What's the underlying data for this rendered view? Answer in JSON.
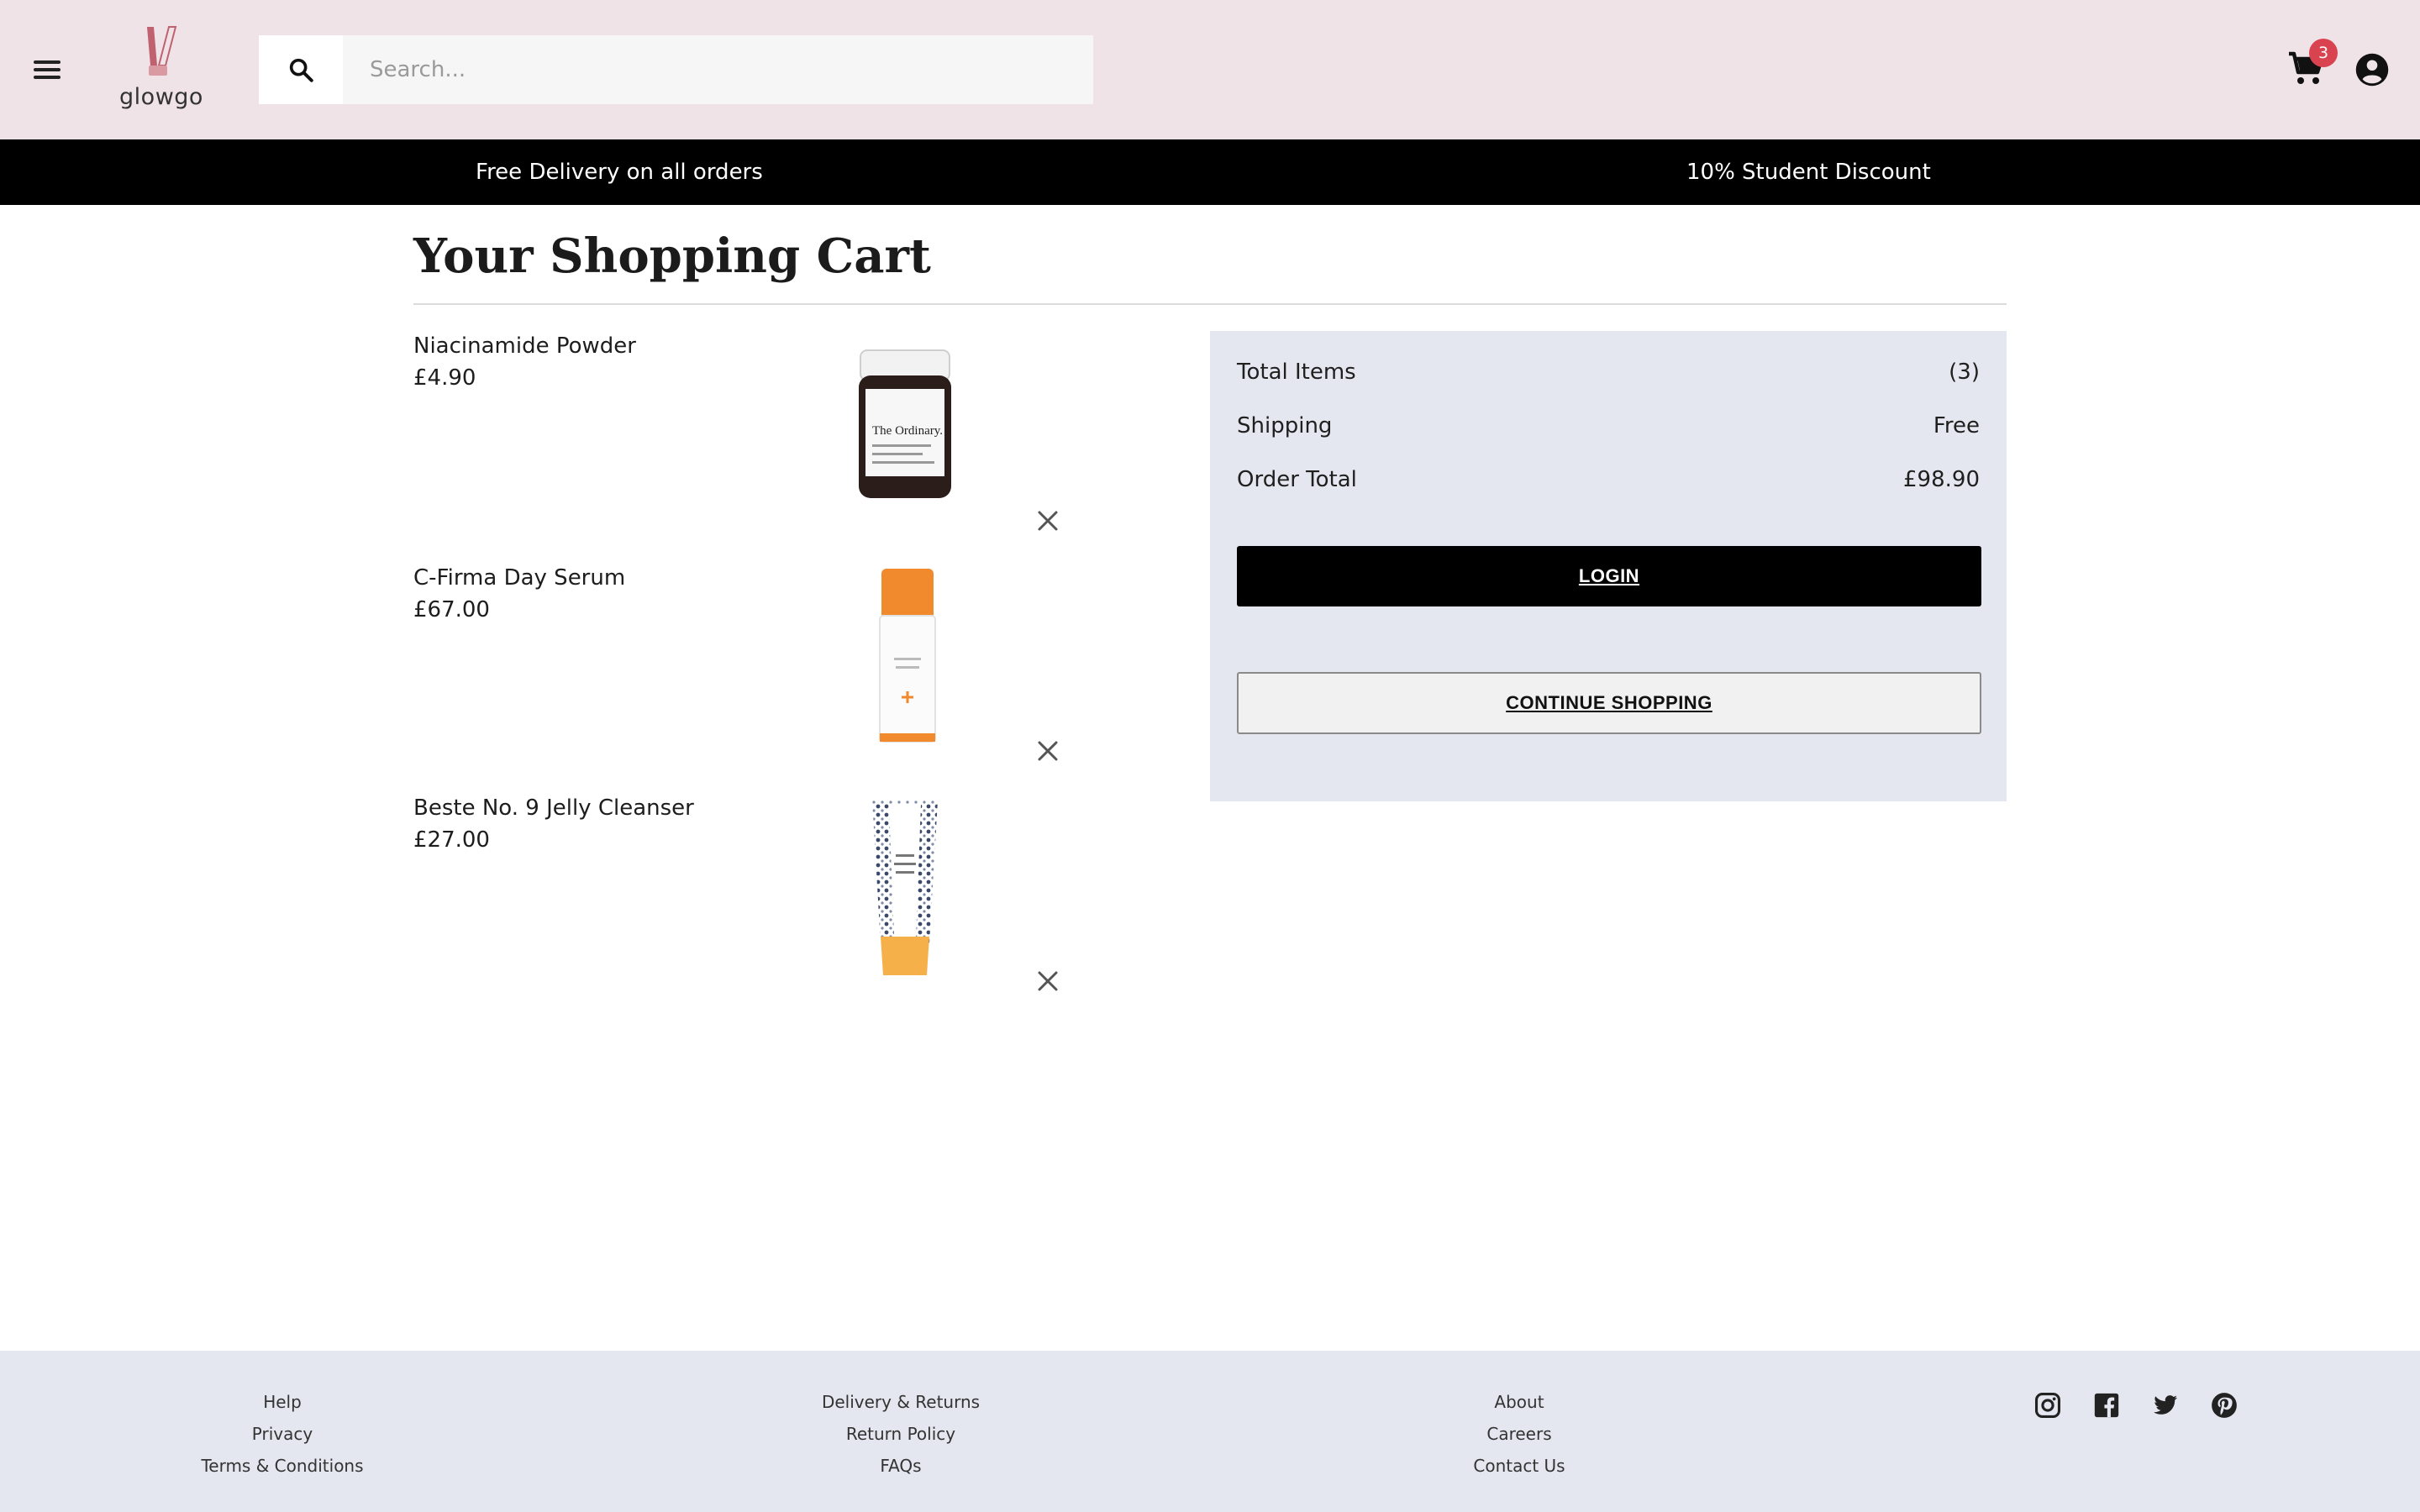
{
  "header": {
    "logo_text": "glowgo",
    "search_placeholder": "Search...",
    "cart_count": "3"
  },
  "promo": {
    "left": "Free Delivery on all orders",
    "right": "10% Student Discount"
  },
  "page": {
    "title": "Your Shopping Cart"
  },
  "cart": {
    "items": [
      {
        "name": "Niacinamide Powder",
        "price": "£4.90"
      },
      {
        "name": "C-Firma Day Serum",
        "price": "£67.00"
      },
      {
        "name": "Beste No. 9 Jelly Cleanser",
        "price": "£27.00"
      }
    ]
  },
  "summary": {
    "total_items_label": "Total Items",
    "total_items_value": "(3)",
    "shipping_label": "Shipping",
    "shipping_value": "Free",
    "order_total_label": "Order Total",
    "order_total_value": "£98.90",
    "login_label": "LOGIN",
    "continue_label": "CONTINUE SHOPPING"
  },
  "footer": {
    "col1": [
      "Help",
      "Privacy",
      "Terms & Conditions"
    ],
    "col2": [
      "Delivery & Returns",
      "Return Policy",
      "FAQs"
    ],
    "col3": [
      "About",
      "Careers",
      "Contact Us"
    ],
    "socials": [
      "instagram-icon",
      "facebook-icon",
      "twitter-icon",
      "pinterest-icon"
    ]
  },
  "colors": {
    "header_bg": "#efe3e8",
    "promo_bg": "#000000",
    "summary_bg": "#e4e7ef",
    "badge": "#d9434f",
    "logo_accent": "#c0616f"
  },
  "product_images": {
    "item0_label": "The Ordinary."
  }
}
